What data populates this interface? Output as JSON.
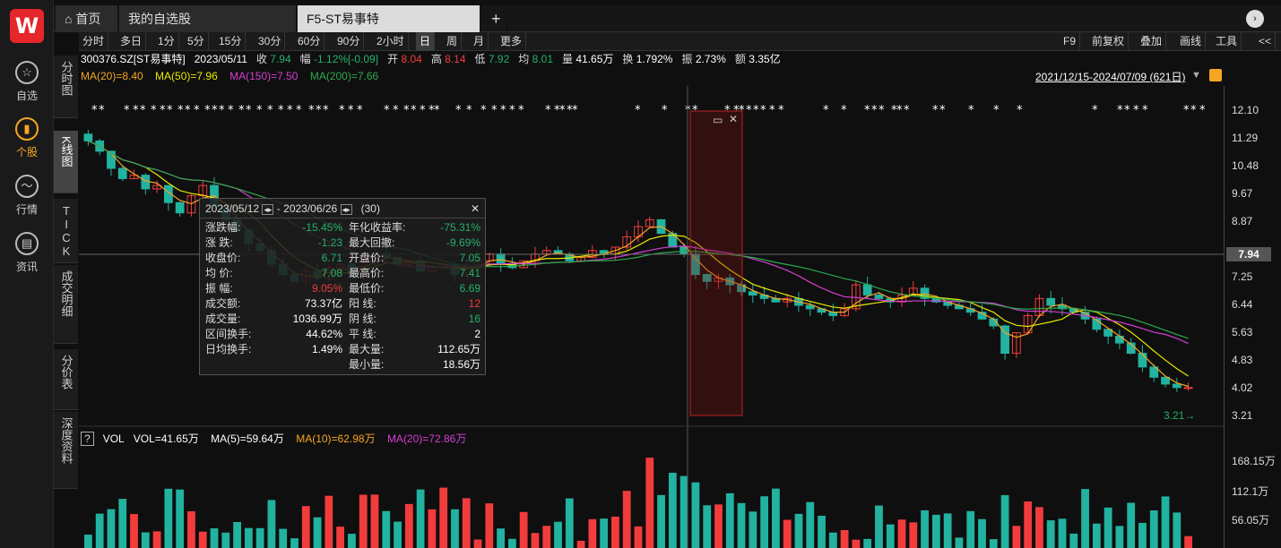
{
  "rail": {
    "logo": "W",
    "items": [
      {
        "label": "自选",
        "icon": "star-icon"
      },
      {
        "label": "个股",
        "icon": "stock-chart-icon",
        "active": true
      },
      {
        "label": "行情",
        "icon": "market-wave-icon"
      },
      {
        "label": "资讯",
        "icon": "news-icon"
      }
    ]
  },
  "tabs": {
    "home": "首页",
    "watchlist": "我的自选股",
    "active": "F5-ST易事特 300376.SZ",
    "close": "✕",
    "add": "+"
  },
  "periods": [
    "分时",
    "多日",
    "1分",
    "5分",
    "15分",
    "30分",
    "60分",
    "90分",
    "2小时",
    "日",
    "周",
    "月",
    "更多"
  ],
  "selected_period": "日",
  "right_tools": [
    "F9",
    "前复权",
    "叠加",
    "画线",
    "工具",
    "<<"
  ],
  "vtabs": [
    "分时图",
    "K线图",
    "TICK",
    "成交明细",
    "分价表",
    "深度资料"
  ],
  "info": {
    "code": "300376.SZ[ST易事特]",
    "date": "2023/05/11",
    "close_label": "收",
    "close": "7.94",
    "chg_label": "幅",
    "chg": "-1.12%[-0.09]",
    "open_label": "开",
    "open": "8.04",
    "high_label": "高",
    "high": "8.14",
    "low_label": "低",
    "low": "7.92",
    "avg_label": "均",
    "avg": "8.01",
    "vol_label": "量",
    "vol": "41.65万",
    "turn_label": "换",
    "turn": "1.792%",
    "amp_label": "振",
    "amp": "2.73%",
    "amt_label": "额",
    "amt": "3.35亿"
  },
  "ma": {
    "ma20": "MA(20)=8.40",
    "ma50": "MA(50)=7.96",
    "ma150": "MA(150)=7.50",
    "ma200": "MA(200)=7.66"
  },
  "colors": {
    "ma20": "#f5a623",
    "ma50": "#e8e800",
    "ma150": "#d43fd4",
    "ma200": "#2fa84f",
    "up": "#f23c3c",
    "down": "#22b2a0"
  },
  "date_range": "2021/12/15-2024/07/09 (621日)",
  "y_labels": [
    "12.10",
    "11.29",
    "10.48",
    "9.67",
    "8.87",
    "7.25",
    "6.44",
    "5.63",
    "4.83",
    "4.02",
    "3.21"
  ],
  "current_price": "7.94",
  "low_marker": "3.21→",
  "tooltip": {
    "range_start": "2023/05/12",
    "range_sep": "-",
    "range_end": "2023/06/26",
    "count": "(30)",
    "close": "✕",
    "left": [
      {
        "k": "涨跌幅:",
        "v": "-15.45%",
        "c": "green"
      },
      {
        "k": "涨  跌:",
        "v": "-1.23",
        "c": "green"
      },
      {
        "k": "收盘价:",
        "v": "6.71",
        "c": "green"
      },
      {
        "k": "均  价:",
        "v": "7.08",
        "c": "green"
      },
      {
        "k": "振  幅:",
        "v": "9.05%",
        "c": "red"
      },
      {
        "k": "成交额:",
        "v": "73.37亿",
        "c": "white"
      },
      {
        "k": "成交量:",
        "v": "1036.99万",
        "c": "white"
      },
      {
        "k": "区间换手:",
        "v": "44.62%",
        "c": "white"
      },
      {
        "k": "日均换手:",
        "v": "1.49%",
        "c": "white"
      }
    ],
    "right": [
      {
        "k": "年化收益率:",
        "v": "-75.31%",
        "c": "green"
      },
      {
        "k": "最大回撤:",
        "v": "-9.69%",
        "c": "green"
      },
      {
        "k": "开盘价:",
        "v": "7.05",
        "c": "green"
      },
      {
        "k": "最高价:",
        "v": "7.41",
        "c": "green"
      },
      {
        "k": "最低价:",
        "v": "6.69",
        "c": "green"
      },
      {
        "k": "阳  线:",
        "v": "12",
        "c": "red"
      },
      {
        "k": "阴  线:",
        "v": "16",
        "c": "green"
      },
      {
        "k": "平  线:",
        "v": "2",
        "c": "white"
      },
      {
        "k": "最大量:",
        "v": "112.65万",
        "c": "white"
      },
      {
        "k": "最小量:",
        "v": "18.56万",
        "c": "white"
      }
    ]
  },
  "vol": {
    "help": "?",
    "label": "VOL",
    "vol": "VOL=41.65万",
    "ma5": "MA(5)=59.64万",
    "ma10": "MA(10)=62.98万",
    "ma20": "MA(20)=72.86万",
    "y_labels": [
      "168.15万",
      "112.1万",
      "56.05万"
    ]
  },
  "chart_data": {
    "type": "candlestick",
    "ylim": [
      3.21,
      12.1
    ],
    "closes": [
      11.2,
      10.9,
      10.4,
      10.1,
      10.2,
      9.8,
      9.9,
      9.4,
      9.1,
      9.6,
      9.9,
      9.3,
      8.9,
      8.6,
      8.2,
      8.0,
      7.6,
      7.3,
      7.1,
      7.4,
      7.2,
      7.5,
      7.6,
      7.3,
      7.7,
      7.9,
      7.8,
      7.6,
      7.7,
      7.4,
      7.5,
      7.6,
      7.3,
      7.5,
      7.7,
      7.9,
      7.6,
      7.5,
      7.7,
      7.9,
      8.0,
      7.9,
      7.7,
      7.8,
      8.0,
      7.9,
      8.1,
      8.4,
      8.7,
      8.9,
      8.5,
      8.1,
      7.9,
      7.3,
      7.1,
      7.2,
      7.0,
      6.8,
      6.7,
      6.6,
      6.5,
      6.6,
      6.4,
      6.3,
      6.2,
      6.1,
      6.3,
      7.0,
      6.7,
      6.6,
      6.5,
      6.7,
      6.9,
      6.6,
      6.5,
      6.4,
      6.3,
      6.2,
      6.0,
      5.8,
      5.0,
      5.6,
      6.1,
      6.6,
      6.4,
      6.3,
      6.2,
      6.0,
      5.7,
      5.5,
      5.3,
      5.0,
      4.6,
      4.3,
      4.1,
      4.0,
      4.0
    ]
  }
}
